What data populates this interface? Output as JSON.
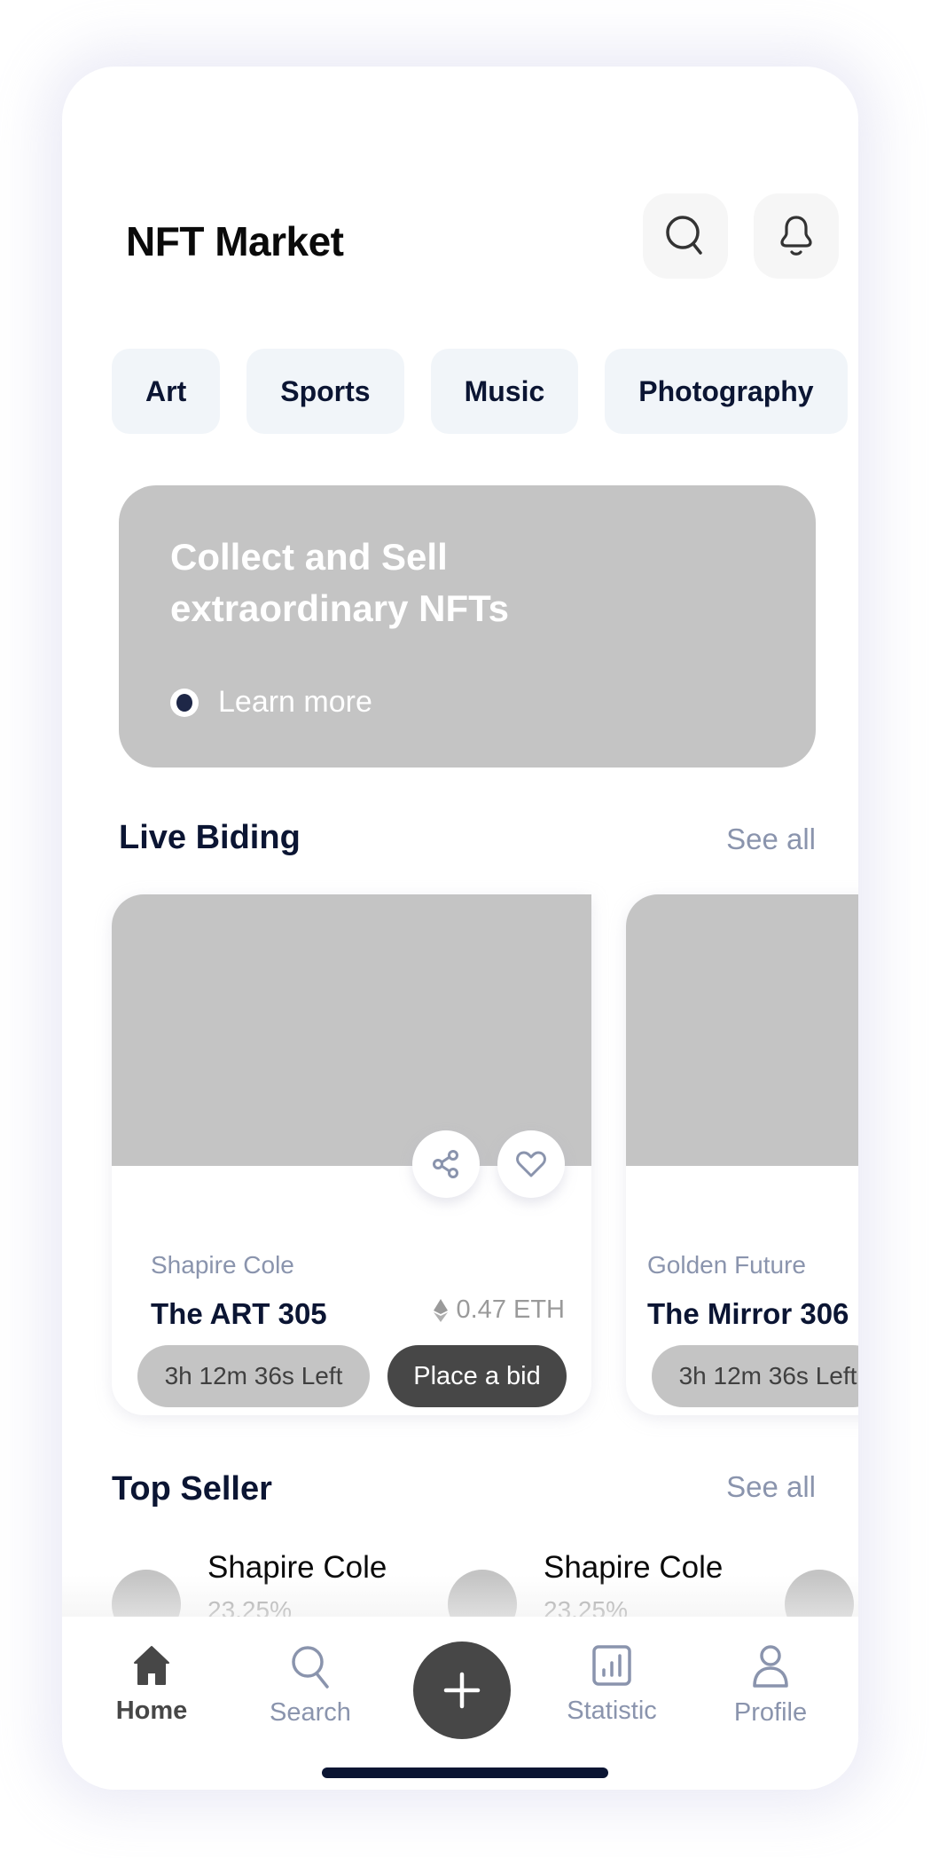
{
  "header": {
    "title": "NFT Market",
    "search_icon": "search-icon",
    "notification_icon": "bell-icon"
  },
  "categories": [
    "Art",
    "Sports",
    "Music",
    "Photography"
  ],
  "banner": {
    "title": "Collect and Sell extraordinary NFTs",
    "link_label": "Learn more"
  },
  "live_bidding": {
    "title": "Live Biding",
    "see_all": "See all",
    "cards": [
      {
        "artist": "Shapire Cole",
        "name": "The ART 305",
        "price": "0.47 ETH",
        "time_left": "3h 12m 36s Left",
        "action": "Place a bid"
      },
      {
        "artist": "Golden Future",
        "name": "The Mirror 306",
        "time_left": "3h 12m 36s Left"
      }
    ]
  },
  "top_seller": {
    "title": "Top Seller",
    "see_all": "See all",
    "sellers": [
      {
        "name": "Shapire Cole",
        "percent": "23.25%"
      },
      {
        "name": "Shapire Cole",
        "percent": "23.25%"
      }
    ]
  },
  "bottom_nav": {
    "items": [
      {
        "label": "Home",
        "icon": "home-icon",
        "active": true
      },
      {
        "label": "Search",
        "icon": "search-icon",
        "active": false
      },
      {
        "label": "Statistic",
        "icon": "chart-icon",
        "active": false
      },
      {
        "label": "Profile",
        "icon": "user-icon",
        "active": false
      }
    ],
    "add_icon": "plus-icon"
  },
  "colors": {
    "primary_dark": "#0b1533",
    "muted": "#8a94ad",
    "placeholder": "#c4c4c4",
    "button_dark": "#474747",
    "chip_bg": "#f1f5f9"
  }
}
